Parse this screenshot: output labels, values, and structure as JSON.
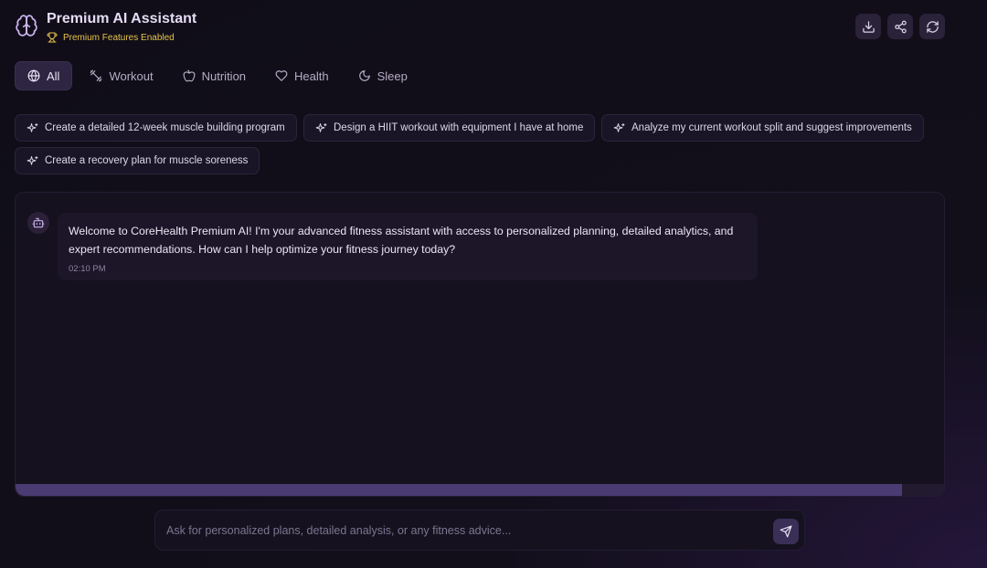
{
  "header": {
    "title": "Premium AI Assistant",
    "subtitle": "Premium Features Enabled",
    "actions": [
      "download-icon",
      "share-icon",
      "refresh-icon"
    ]
  },
  "tabs": [
    {
      "label": "All",
      "icon": "globe-icon",
      "active": true
    },
    {
      "label": "Workout",
      "icon": "dumbbell-icon",
      "active": false
    },
    {
      "label": "Nutrition",
      "icon": "apple-icon",
      "active": false
    },
    {
      "label": "Health",
      "icon": "heart-icon",
      "active": false
    },
    {
      "label": "Sleep",
      "icon": "moon-icon",
      "active": false
    }
  ],
  "suggestions": [
    "Create a detailed 12-week muscle building program",
    "Design a HIIT workout with equipment I have at home",
    "Analyze my current workout split and suggest improvements",
    "Create a recovery plan for muscle soreness"
  ],
  "chat": {
    "messages": [
      {
        "sender": "bot",
        "text": "Welcome to CoreHealth Premium AI! I'm your advanced fitness assistant with access to personalized planning, detailed analytics, and expert recommendations. How can I help optimize your fitness journey today?",
        "time": "02:10 PM"
      }
    ],
    "scroll_position": 0.955
  },
  "input": {
    "placeholder": "Ask for personalized plans, detailed analysis, or any fitness advice...",
    "value": ""
  },
  "colors": {
    "accent": "#c9b3f0",
    "gold": "#e8c34a",
    "background": "#120f1b"
  }
}
